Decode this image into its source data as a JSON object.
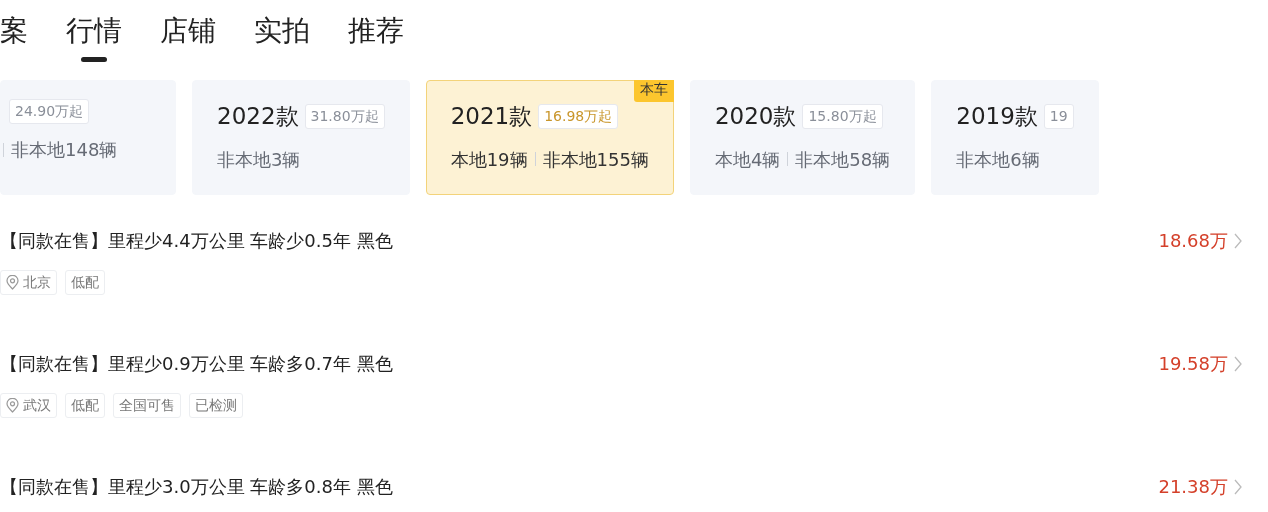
{
  "tabs": [
    {
      "label": "案",
      "selected": false
    },
    {
      "label": "行情",
      "selected": true
    },
    {
      "label": "店铺",
      "selected": false
    },
    {
      "label": "实拍",
      "selected": false
    },
    {
      "label": "推荐",
      "selected": false
    }
  ],
  "model_cards": [
    {
      "price": "24.90万起",
      "nonlocal": "非本地148辆",
      "selected": false,
      "divider": true
    },
    {
      "year": "2022款",
      "price": "31.80万起",
      "nonlocal": "非本地3辆",
      "selected": false,
      "divider": false
    },
    {
      "year": "2021款",
      "price": "16.98万起",
      "local": "本地19辆",
      "nonlocal": "非本地155辆",
      "selected": true,
      "divider": true,
      "tag": "本车"
    },
    {
      "year": "2020款",
      "price": "15.80万起",
      "local": "本地4辆",
      "nonlocal": "非本地58辆",
      "selected": false,
      "divider": true
    },
    {
      "year": "2019款",
      "price": "19",
      "nonlocal": "非本地6辆",
      "selected": false,
      "divider": false
    }
  ],
  "listings": [
    {
      "title": "【同款在售】里程少4.4万公里 车龄少0.5年 黑色",
      "price": "18.68万",
      "tags": [
        {
          "kind": "location",
          "text": "北京"
        },
        {
          "kind": "plain",
          "text": "低配"
        }
      ]
    },
    {
      "title": "【同款在售】里程少0.9万公里 车龄多0.7年 黑色",
      "price": "19.58万",
      "tags": [
        {
          "kind": "location",
          "text": "武汉"
        },
        {
          "kind": "plain",
          "text": "低配"
        },
        {
          "kind": "plain",
          "text": "全国可售"
        },
        {
          "kind": "plain",
          "text": "已检测"
        }
      ]
    },
    {
      "title": "【同款在售】里程少3.0万公里 车龄多0.8年 黑色",
      "price": "21.38万"
    }
  ]
}
